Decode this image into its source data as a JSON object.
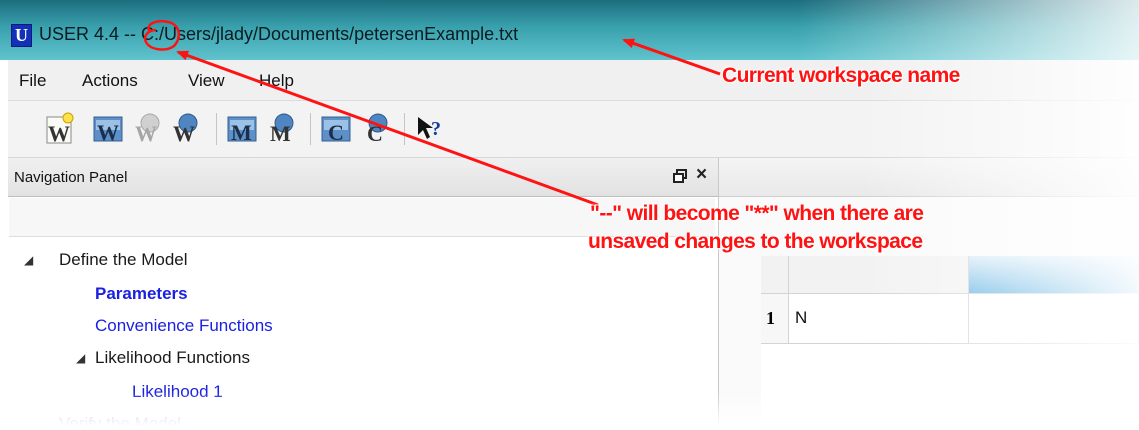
{
  "window": {
    "icon_letter": "U",
    "title": "USER 4.4 -- C:/Users/jlady/Documents/petersenExample.txt",
    "title_bar_color": "#39a1ad"
  },
  "menu": {
    "items": [
      "File",
      "Actions",
      "View",
      "Help"
    ]
  },
  "toolbar": {
    "buttons": [
      {
        "name": "new-workspace-icon",
        "glyph": "W"
      },
      {
        "name": "open-workspace-icon",
        "glyph": "W"
      },
      {
        "name": "save-workspace-icon",
        "glyph": "W"
      },
      {
        "name": "save-workspace-as-icon",
        "glyph": "W"
      },
      {
        "name": "open-model-icon",
        "glyph": "M"
      },
      {
        "name": "save-model-icon",
        "glyph": "M"
      },
      {
        "name": "open-computation-icon",
        "glyph": "C"
      },
      {
        "name": "save-computation-icon",
        "glyph": "C"
      },
      {
        "name": "context-help-icon",
        "glyph": "?"
      }
    ]
  },
  "navigation_panel": {
    "title": "Navigation Panel",
    "tree": {
      "define_model": "Define the Model",
      "parameters": "Parameters",
      "convenience_functions": "Convenience Functions",
      "likelihood_functions": "Likelihood Functions",
      "likelihood_1": "Likelihood 1",
      "verify_model": "Verify the Model"
    }
  },
  "grid": {
    "row_number": "1",
    "cell_value": "N"
  },
  "annotations": {
    "workspace_name_label": "Current workspace name",
    "unsaved_line1": "\"--\" will become \"**\" when there are",
    "unsaved_line2": "unsaved changes to the workspace",
    "color": "#ff1212"
  }
}
